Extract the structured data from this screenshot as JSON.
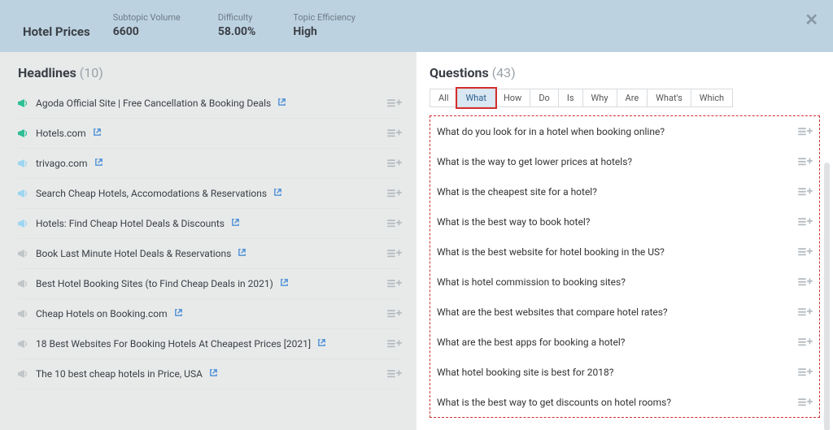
{
  "header": {
    "title": "Hotel Prices",
    "metrics": [
      {
        "label": "Subtopic Volume",
        "value": "6600"
      },
      {
        "label": "Difficulty",
        "value": "58.00%"
      },
      {
        "label": "Topic Efficiency",
        "value": "High"
      }
    ]
  },
  "headlines": {
    "title": "Headlines",
    "count": "(10)",
    "items": [
      {
        "text": "Agoda Official Site | Free Cancellation & Booking Deals",
        "adColor": "#2fbf95"
      },
      {
        "text": "Hotels.com",
        "adColor": "#2fbf95"
      },
      {
        "text": "trivago.com",
        "adColor": "#9ed6f0"
      },
      {
        "text": "Search Cheap Hotels, Accomodations & Reservations",
        "adColor": "#9ed6f0"
      },
      {
        "text": "Hotels: Find Cheap Hotel Deals & Discounts",
        "adColor": "#9ed6f0"
      },
      {
        "text": "Book Last Minute Hotel Deals & Reservations",
        "adColor": "#c1c6c9"
      },
      {
        "text": "Best Hotel Booking Sites (to Find Cheap Deals in 2021)",
        "adColor": "#c1c6c9"
      },
      {
        "text": "Cheap Hotels on Booking.com",
        "adColor": "#c1c6c9"
      },
      {
        "text": "18 Best Websites For Booking Hotels At Cheapest Prices [2021]",
        "adColor": "#c1c6c9"
      },
      {
        "text": "The 10 best cheap hotels in Price, USA",
        "adColor": "#c1c6c9"
      }
    ]
  },
  "questions": {
    "title": "Questions",
    "count": "(43)",
    "tabs": [
      "All",
      "What",
      "How",
      "Do",
      "Is",
      "Why",
      "Are",
      "What's",
      "Which"
    ],
    "activeTab": "What",
    "items": [
      "What do you look for in a hotel when booking online?",
      "What is the way to get lower prices at hotels?",
      "What is the cheapest site for a hotel?",
      "What is the best way to book hotel?",
      "What is the best website for hotel booking in the US?",
      "What is hotel commission to booking sites?",
      "What are the best websites that compare hotel rates?",
      "What are the best apps for booking a hotel?",
      "What hotel booking site is best for 2018?",
      "What is the best way to get discounts on hotel rooms?"
    ]
  }
}
